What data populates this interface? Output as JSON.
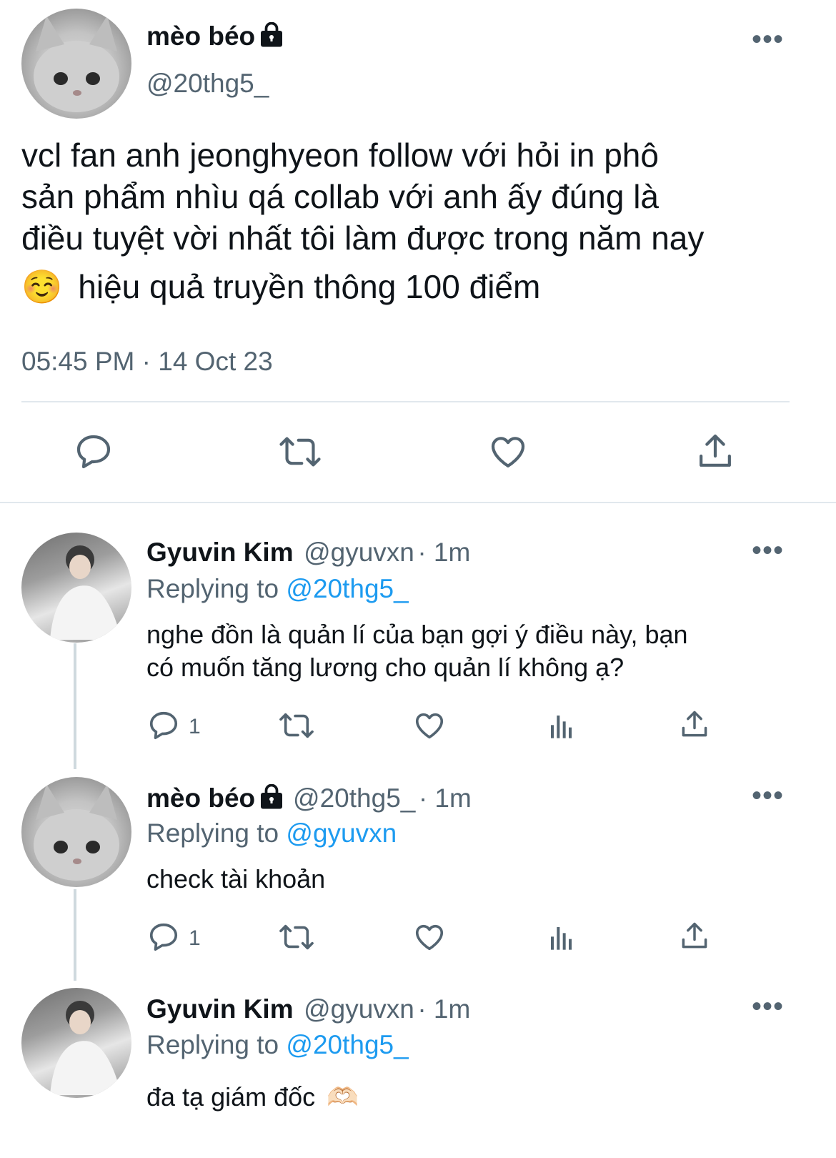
{
  "main_tweet": {
    "display_name": "mèo béo",
    "handle": "@20thg5_",
    "text_lines": [
      "vcl fan anh jeonghyeon follow với hỏi in phô",
      "sản phẩm nhìu qá collab với anh ấy đúng là",
      "điều tuyệt vời nhất tôi làm được trong năm nay",
      "hiệu quả truyền thông 100 điểm"
    ],
    "emoji": "☺️",
    "timestamp": "05:45 PM · 14 Oct 23"
  },
  "replies": [
    {
      "display_name": "Gyuvin Kim",
      "handle": "@gyuvxn",
      "time": "· 1m",
      "replying_prefix": "Replying to",
      "replying_to": "@20thg5_",
      "text_lines": [
        "nghe đồn là quản lí của bạn gợi ý điều này, bạn",
        "có muốn tăng lương cho quản lí không ạ?"
      ],
      "reply_count": "1"
    },
    {
      "display_name": "mèo béo",
      "handle": "@20thg5_",
      "time": "· 1m",
      "replying_prefix": "Replying to",
      "replying_to": "@gyuvxn",
      "text_lines": [
        "check tài khoản"
      ],
      "reply_count": "1"
    },
    {
      "display_name": "Gyuvin Kim",
      "handle": "@gyuvxn",
      "time": "· 1m",
      "replying_prefix": "Replying to",
      "replying_to": "@20thg5_",
      "text_lines": [
        "đa tạ giám đốc"
      ],
      "emoji": "🫶🏻"
    }
  ],
  "icons": [
    "lock-icon",
    "more-icon",
    "reply-icon",
    "retweet-icon",
    "like-icon",
    "share-icon",
    "views-icon"
  ],
  "colors": {
    "accent": "#1d9bf0",
    "secondary_text": "#536471",
    "divider": "#e1e8ed"
  }
}
